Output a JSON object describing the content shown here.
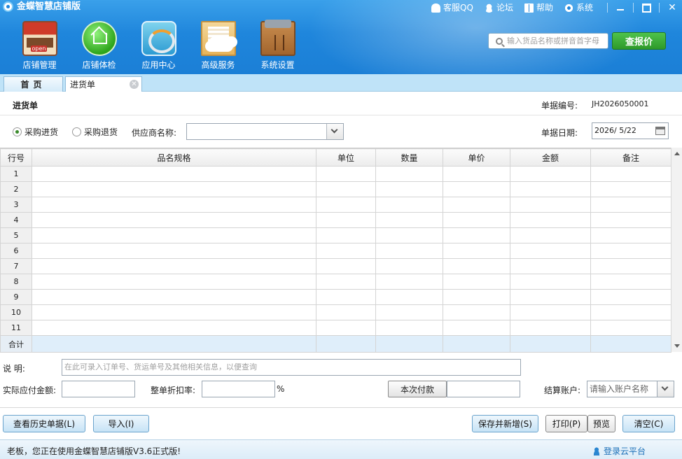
{
  "app": {
    "title": "金蝶智慧店铺版"
  },
  "top_links": [
    {
      "label": "客服QQ",
      "icon": "bell-icon"
    },
    {
      "label": "论坛",
      "icon": "person-icon"
    },
    {
      "label": "帮助",
      "icon": "book-icon"
    },
    {
      "label": "系统",
      "icon": "gear-icon"
    }
  ],
  "window": {
    "close": "✕"
  },
  "toolbar": [
    {
      "label": "店铺管理",
      "icon": "storefront-icon"
    },
    {
      "label": "店铺体检",
      "icon": "home-check-icon"
    },
    {
      "label": "应用中心",
      "icon": "app-center-icon"
    },
    {
      "label": "高级服务",
      "icon": "cloud-service-icon"
    },
    {
      "label": "系统设置",
      "icon": "toolbox-icon"
    }
  ],
  "search": {
    "placeholder": "输入货品名称或拼音首字母",
    "button": "查报价"
  },
  "tabs": {
    "home": "首页",
    "doc": "进货单",
    "close": "✕"
  },
  "form": {
    "title": "进货单",
    "doc_no_label": "单据编号:",
    "doc_no": "JH2026050001",
    "radio_purchase": "采购进货",
    "radio_return": "采购退货",
    "supplier_label": "供应商名称:",
    "supplier_value": "",
    "date_label": "单据日期:",
    "date_value": "2026/ 5/22"
  },
  "grid": {
    "headers": [
      "行号",
      "品名规格",
      "单位",
      "数量",
      "单价",
      "金额",
      "备注"
    ],
    "row_numbers": [
      "1",
      "2",
      "3",
      "4",
      "5",
      "6",
      "7",
      "8",
      "9",
      "10",
      "11"
    ],
    "sum_label": "合计"
  },
  "bottom": {
    "note_label": "说    明:",
    "note_placeholder": "在此可录入订单号、货运单号及其他相关信息，以便查询",
    "payable_label": "实际应付金额:",
    "discount_label": "整单折扣率:",
    "percent": "%",
    "pay_button": "本次付款",
    "account_label": "结算账户:",
    "account_placeholder": "请输入账户名称"
  },
  "buttons": {
    "history": "查看历史单据(L)",
    "import": "导入(I)",
    "save_new": "保存并新增(S)",
    "print": "打印(P)",
    "preview": "预览",
    "clear": "清空(C)"
  },
  "status": {
    "text": "老板，您正在使用金蝶智慧店铺版V3.6正式版!",
    "login": "登录云平台"
  }
}
